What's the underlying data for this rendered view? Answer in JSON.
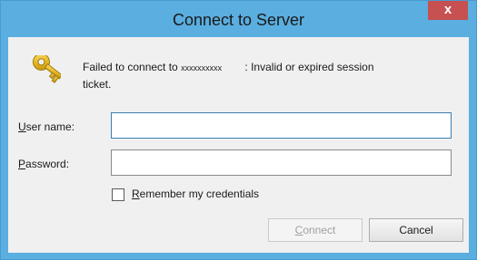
{
  "window": {
    "title": "Connect to Server",
    "close_label": "x"
  },
  "message": {
    "prefix": "Failed to connect to",
    "server": "xxxxxxxxxx",
    "suffix": ": Invalid or expired session",
    "line2": "ticket."
  },
  "form": {
    "username_label_accel": "U",
    "username_label_rest": "ser name:",
    "username_value": "",
    "password_label_accel": "P",
    "password_label_rest": "assword:",
    "password_value": "",
    "remember_label_accel": "R",
    "remember_label_rest": "emember my credentials",
    "remember_checked": false
  },
  "buttons": {
    "connect_accel": "C",
    "connect_rest": "onnect",
    "cancel": "Cancel"
  },
  "colors": {
    "frame": "#5aaee0",
    "close": "#c75050",
    "client": "#f0f0f0",
    "key": "#e8b820"
  },
  "icons": {
    "dialog_icon": "key-icon"
  }
}
